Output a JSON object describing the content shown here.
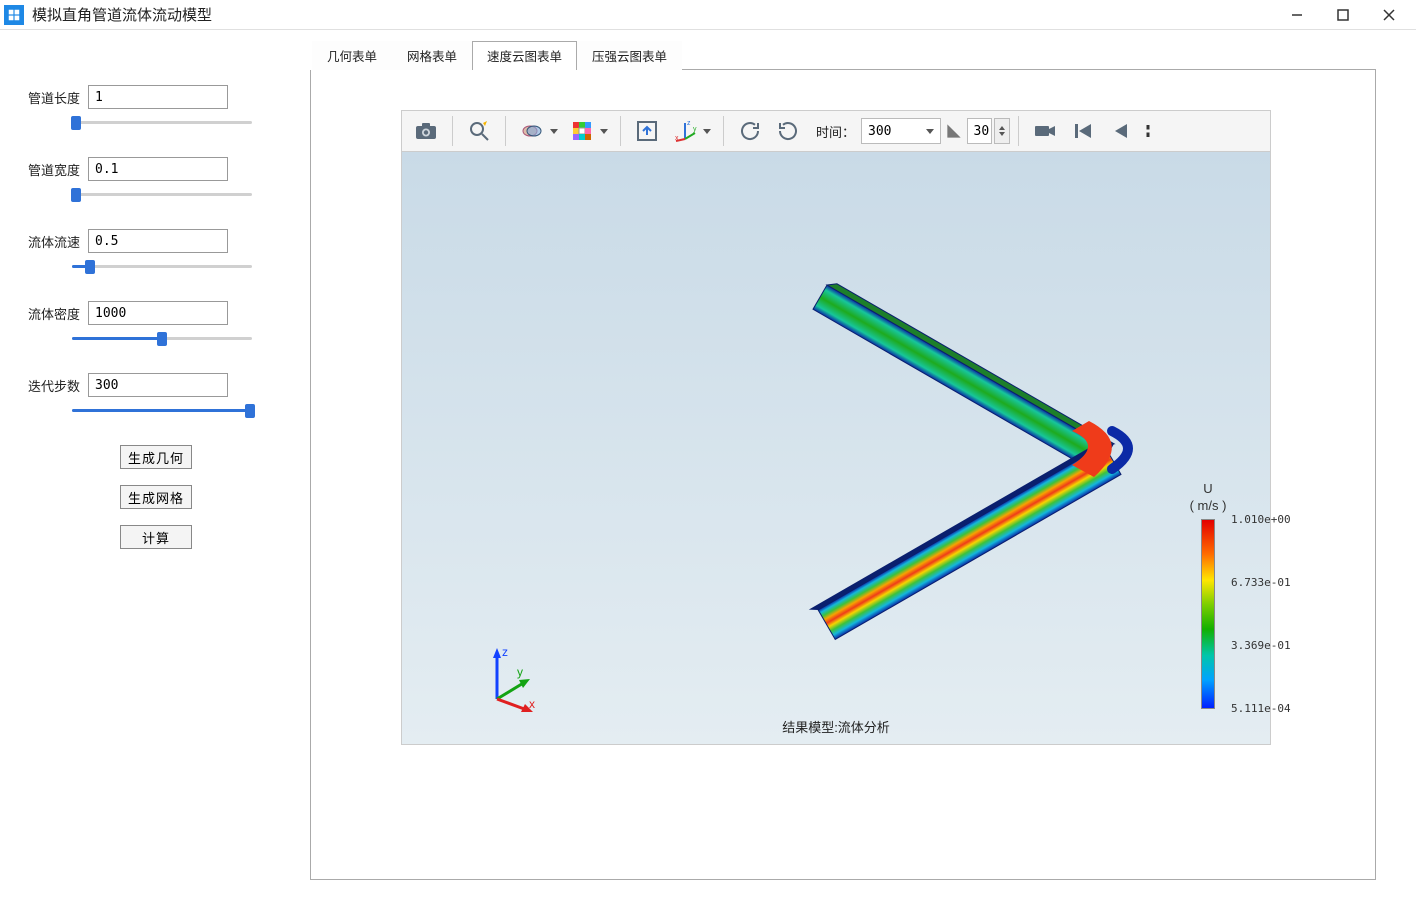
{
  "window": {
    "title": "模拟直角管道流体流动模型"
  },
  "params": {
    "pipe_length": {
      "label": "管道长度",
      "value": "1",
      "pct": 2
    },
    "pipe_width": {
      "label": "管道宽度",
      "value": "0.1",
      "pct": 2
    },
    "fluid_speed": {
      "label": "流体流速",
      "value": "0.5",
      "pct": 10
    },
    "fluid_density": {
      "label": "流体密度",
      "value": "1000",
      "pct": 50
    },
    "iter_steps": {
      "label": "迭代步数",
      "value": "300",
      "pct": 99
    }
  },
  "buttons": {
    "gen_geom": "生成几何",
    "gen_mesh": "生成网格",
    "compute": "计算"
  },
  "tabs": {
    "items": [
      "几何表单",
      "网格表单",
      "速度云图表单",
      "压强云图表单"
    ],
    "active_index": 2
  },
  "toolbar": {
    "time_label": "时间：",
    "time_value": "300",
    "frame_value": "30"
  },
  "legend": {
    "title": "U",
    "unit": "( m/s )",
    "ticks": [
      "1.010e+00",
      "6.733e-01",
      "3.369e-01",
      "5.111e-04"
    ]
  },
  "triad": {
    "x": "x",
    "y": "y",
    "z": "z"
  },
  "caption": "结果模型:流体分析"
}
